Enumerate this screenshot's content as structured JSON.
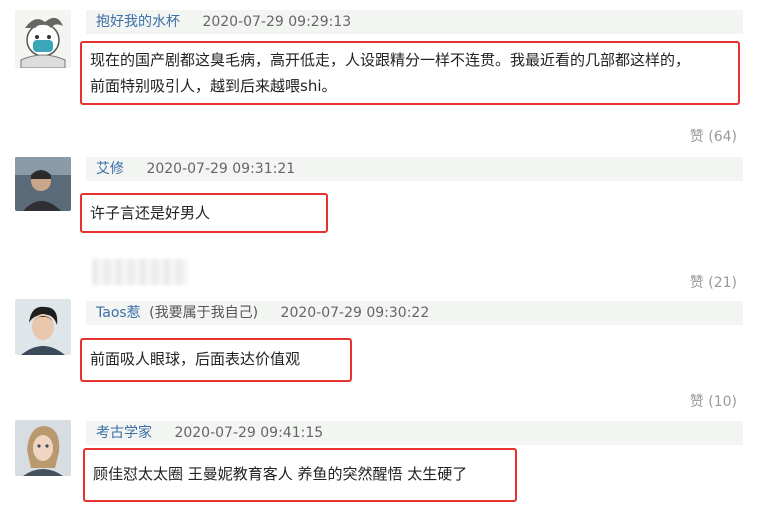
{
  "comments": [
    {
      "user": "抱好我的水杯",
      "note": "",
      "time": "2020-07-29 09:29:13",
      "lines": [
        "现在的国产剧都这臭毛病，高开低走，人设跟精分一样不连贯。我最近看的几部都这样的，",
        "前面特别吸引人，越到后来越喂shi。"
      ],
      "likes": "赞 (64)"
    },
    {
      "user": "艾修",
      "note": "",
      "time": "2020-07-29 09:31:21",
      "lines": [
        "许子言还是好男人"
      ],
      "likes": "赞 (21)"
    },
    {
      "user": "Taos惹",
      "note": "(我要属于我自己)",
      "time": "2020-07-29 09:30:22",
      "lines": [
        "前面吸人眼球，后面表达价值观"
      ],
      "likes": "赞 (10)"
    },
    {
      "user": "考古学家",
      "note": "",
      "time": "2020-07-29 09:41:15",
      "lines": [
        "顾佳怼太太圈 王曼妮教育客人 养鱼的突然醒悟 太生硬了"
      ],
      "likes": ""
    }
  ],
  "colors": {
    "highlight": "#e8322d",
    "username": "#3d6fa8",
    "header_bg": "#f2f5f2"
  }
}
